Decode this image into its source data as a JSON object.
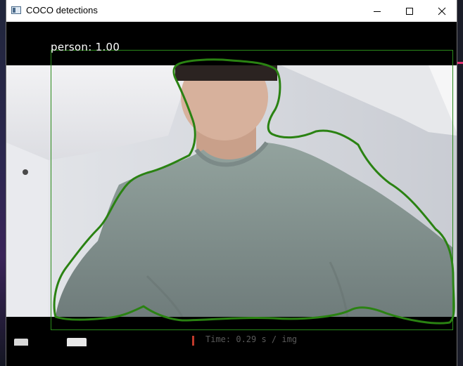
{
  "window": {
    "title": "COCO detections",
    "buttons": {
      "minimize": "minimize",
      "maximize": "maximize",
      "close": "close"
    }
  },
  "detection": {
    "label_text": "person: 1.00",
    "class": "person",
    "score": 1.0,
    "mask_color": "#2a8212",
    "box_color": "#2a8a1a"
  },
  "background": {
    "terminal_text": "Time: 0.29 s / img"
  },
  "colors": {
    "title_bg": "#ffffff",
    "window_bg": "#000000",
    "label_color": "#ffffff"
  }
}
